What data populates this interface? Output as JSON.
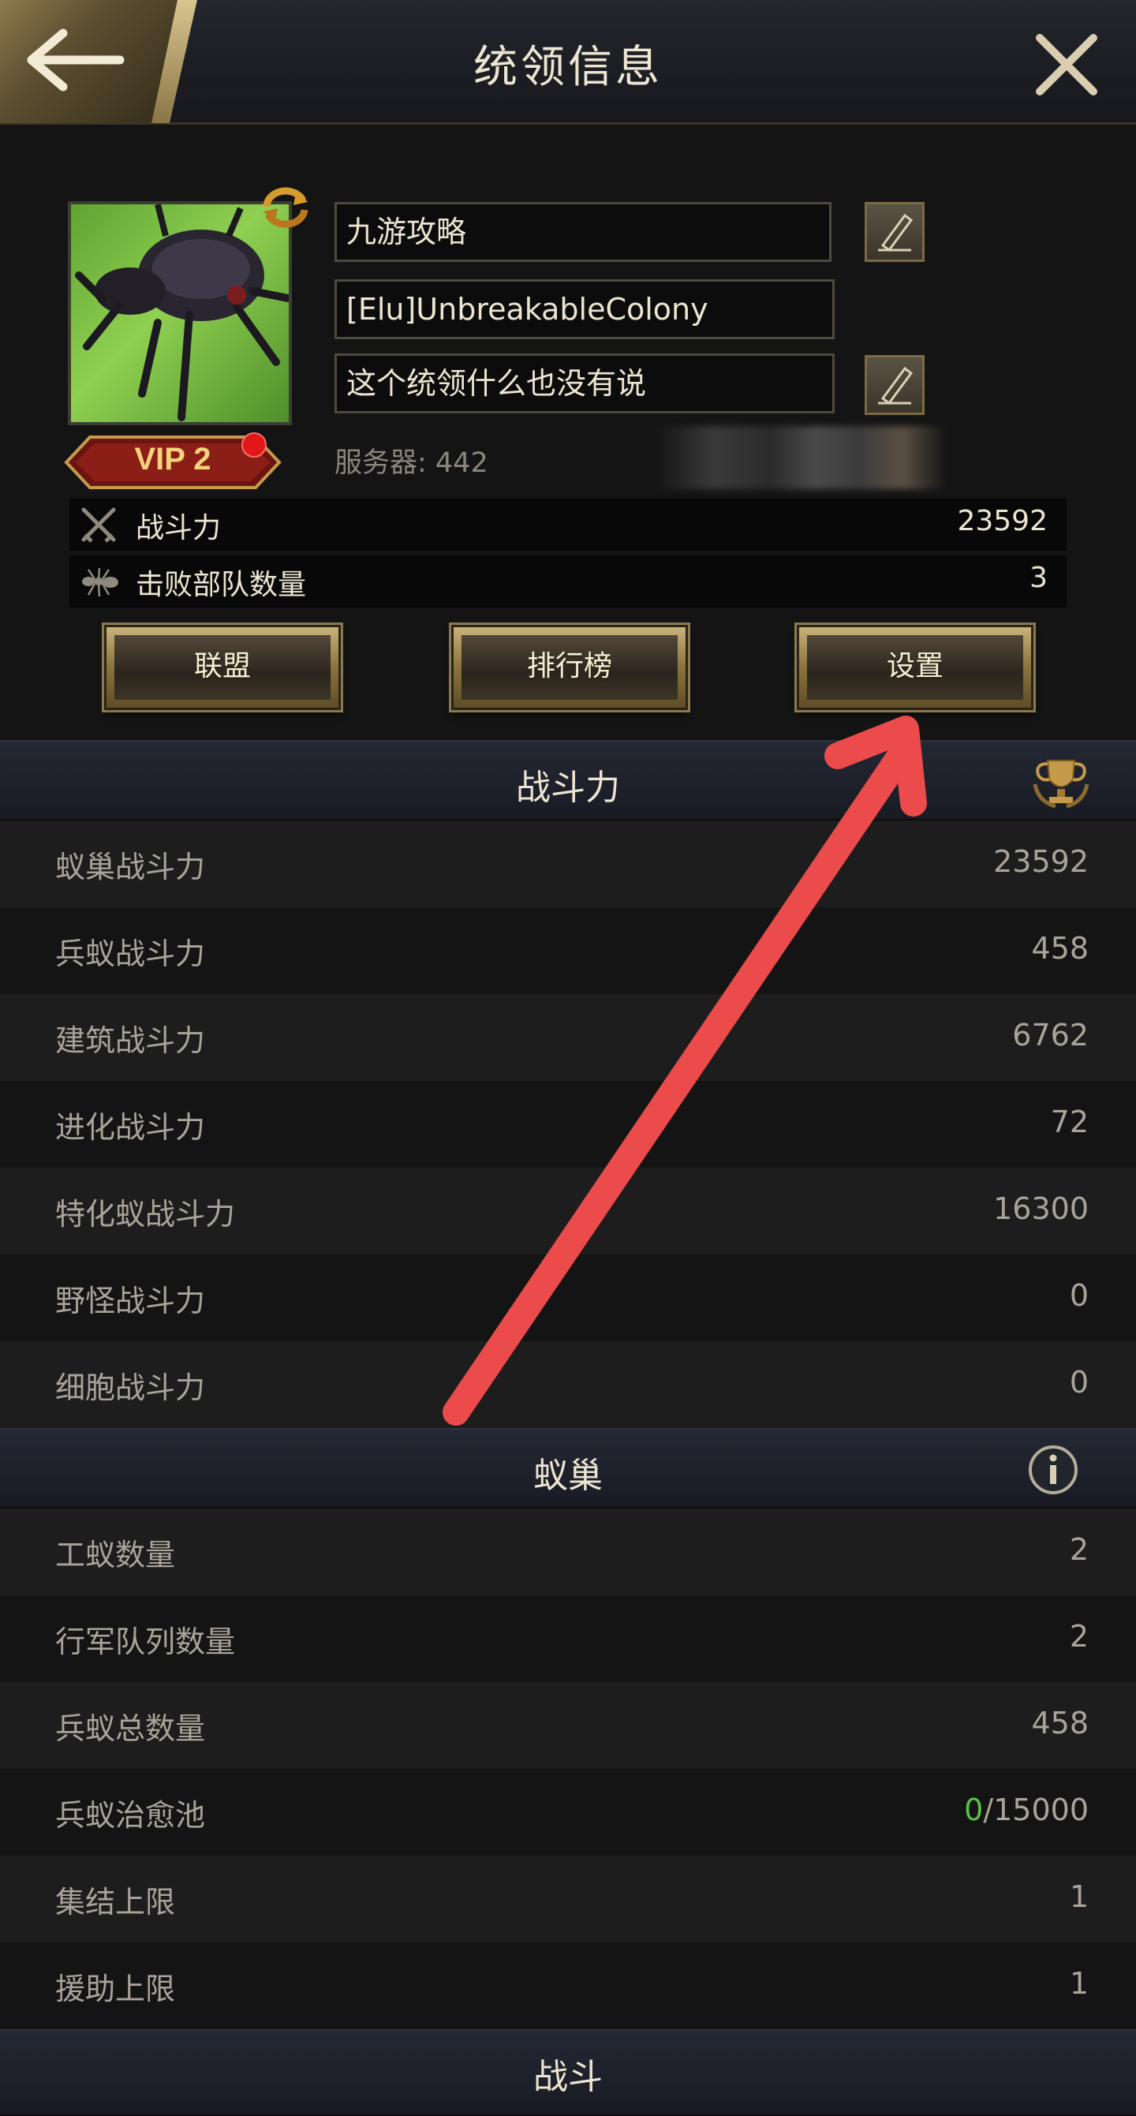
{
  "header": {
    "title": "统领信息",
    "back_icon": "back-arrow-icon",
    "close_icon": "close-icon"
  },
  "profile": {
    "vip_label": "VIP 2",
    "name": "九游攻略",
    "alliance_tag": "[Elu]UnbreakableColony",
    "signature": "这个统领什么也没有说",
    "server": "服务器: 442"
  },
  "stats": {
    "power_label": "战斗力",
    "power_value": "23592",
    "kills_label": "击败部队数量",
    "kills_value": "3"
  },
  "buttons": {
    "alliance": "联盟",
    "ranking": "排行榜",
    "settings": "设置"
  },
  "power_section": {
    "title": "战斗力",
    "rows": [
      {
        "label": "蚁巢战斗力",
        "value": "23592"
      },
      {
        "label": "兵蚁战斗力",
        "value": "458"
      },
      {
        "label": "建筑战斗力",
        "value": "6762"
      },
      {
        "label": "进化战斗力",
        "value": "72"
      },
      {
        "label": "特化蚁战斗力",
        "value": "16300"
      },
      {
        "label": "野怪战斗力",
        "value": "0"
      },
      {
        "label": "细胞战斗力",
        "value": "0"
      }
    ]
  },
  "nest_section": {
    "title": "蚁巢",
    "rows": [
      {
        "label": "工蚁数量",
        "value": "2"
      },
      {
        "label": "行军队列数量",
        "value": "2"
      },
      {
        "label": "兵蚁总数量",
        "value": "458"
      },
      {
        "label": "兵蚁治愈池",
        "value_current": "0",
        "value_rest": "/15000"
      },
      {
        "label": "集结上限",
        "value": "1"
      },
      {
        "label": "援助上限",
        "value": "1"
      }
    ]
  },
  "battle_section": {
    "title": "战斗"
  },
  "colors": {
    "accent_gold": "#c8b27a",
    "annotation_arrow": "#ec4b4b",
    "positive_green": "#59c247"
  }
}
